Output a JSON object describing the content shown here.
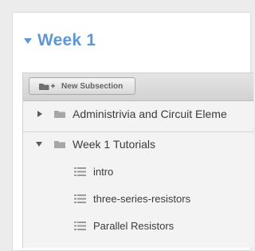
{
  "week": {
    "title": "Week 1"
  },
  "toolbar": {
    "new_subsection_label": "New Subsection"
  },
  "subsections": [
    {
      "label": "Administrivia and Circuit Eleme",
      "expanded": false
    },
    {
      "label": "Week 1 Tutorials",
      "expanded": true
    }
  ],
  "units": [
    {
      "label": "intro"
    },
    {
      "label": "three-series-resistors"
    },
    {
      "label": "Parallel Resistors"
    }
  ],
  "colors": {
    "accent": "#5f97d6",
    "text": "#3b3b3b",
    "icon": "#9a9a9a"
  }
}
